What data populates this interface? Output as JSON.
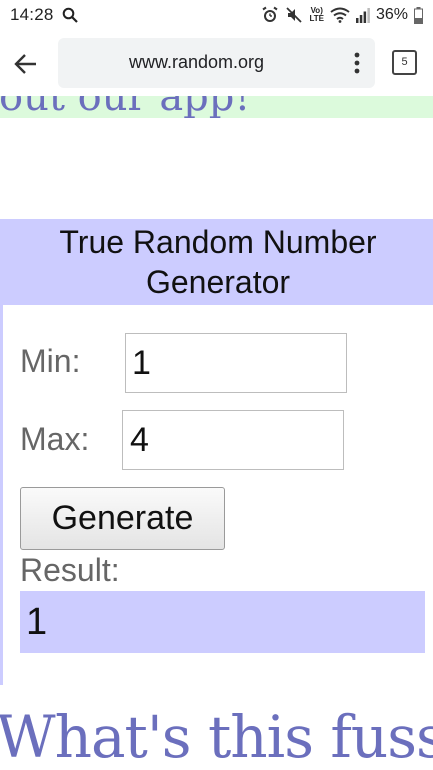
{
  "status_bar": {
    "time": "14:28",
    "volte_line1": "Vo)",
    "volte_line2": "LTE",
    "battery": "36%"
  },
  "browser": {
    "url": "www.random.org",
    "tab_count": "5"
  },
  "page": {
    "banner_text": "out our app!",
    "widget": {
      "title": "True Random Number Generator",
      "min_label": "Min:",
      "min_value": "1",
      "max_label": "Max:",
      "max_value": "4",
      "generate_label": "Generate",
      "result_label": "Result:",
      "result_value": "1"
    },
    "next_heading": "What's this fuss"
  },
  "colors": {
    "widget_bg": "#ccccff",
    "banner_bg": "#dcfadc",
    "heading_color": "#6b6fbd"
  }
}
